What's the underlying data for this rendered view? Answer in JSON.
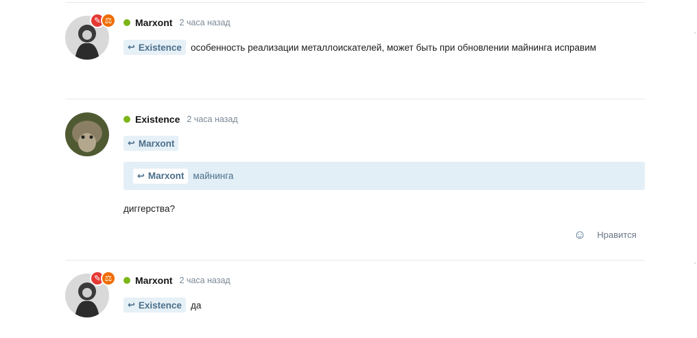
{
  "comments": [
    {
      "author": "Marxont",
      "time": "2 часа назад",
      "reply_to": "Existence",
      "text": "особенность реализации металлоискателей, может быть при обновлении майнинга исправим"
    },
    {
      "author": "Existence",
      "time": "2 часа назад",
      "reply_to": "Marxont",
      "quote": {
        "reply_to": "Marxont",
        "text": "майнинга"
      },
      "text": "диггерства?",
      "like_label": "Нравится"
    },
    {
      "author": "Marxont",
      "time": "2 часа назад",
      "reply_to": "Existence",
      "text": "да"
    }
  ],
  "colors": {
    "online": "#7cb518",
    "chip_bg": "#e6f0f7",
    "chip_text": "#4b6f8a",
    "badge_red": "#e53935",
    "badge_orange": "#ef6c00"
  },
  "icons": {
    "reply": "reply-arrow-icon",
    "like": "add-reaction-icon",
    "badge1": "pencil-icon",
    "badge2": "scales-icon"
  }
}
